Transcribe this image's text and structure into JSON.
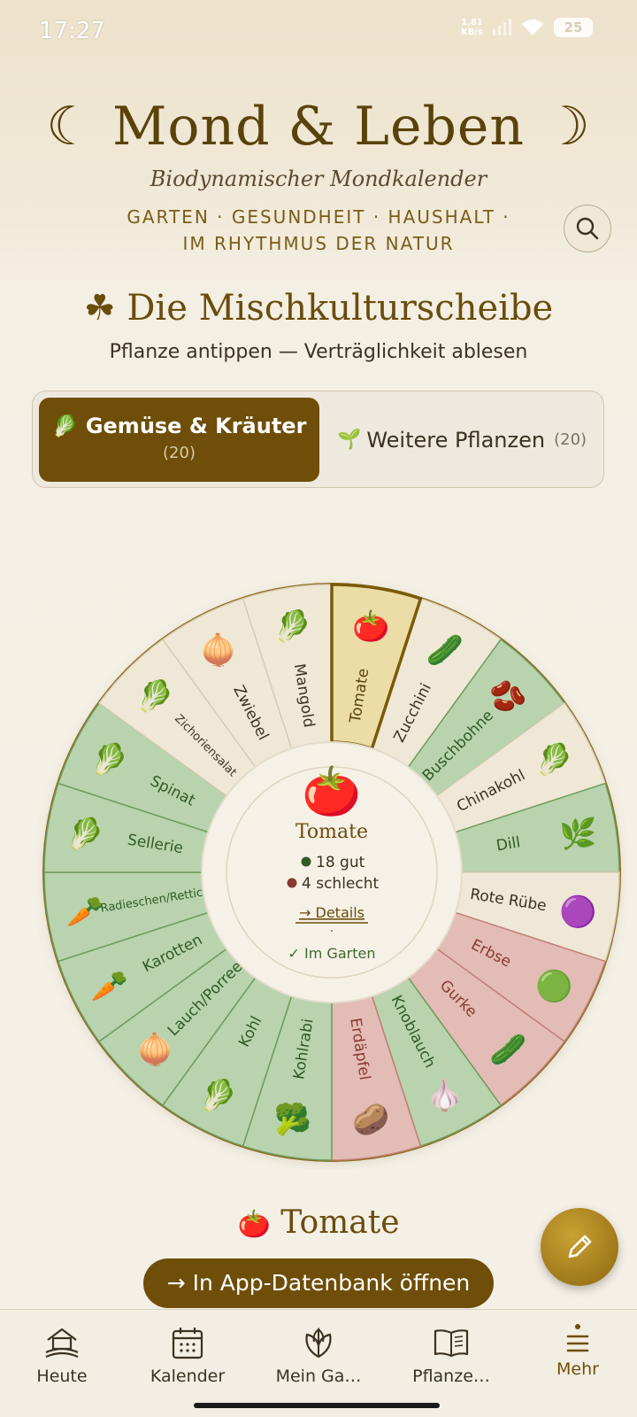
{
  "status_bar": {
    "time": "17:27",
    "net_speed_value": "1,81",
    "net_speed_unit": "KB/s",
    "battery": "25"
  },
  "header": {
    "title": "☾ Mond & Leben ☽",
    "subtitle": "Biodynamischer Mondkalender",
    "tagline_line1": "GARTEN · GESUNDHEIT · HAUSHALT ·",
    "tagline_line2": "IM RHYTHMUS DER NATUR"
  },
  "section": {
    "title": "☘ Die Mischkulturscheibe",
    "hint": "Pflanze antippen — Verträglichkeit ablesen"
  },
  "tabs": [
    {
      "icon": "🥬",
      "label": "Gemüse & Kräuter",
      "count": "(20)",
      "active": true
    },
    {
      "icon": "🌱",
      "label": "Weitere Pflanzen",
      "count": "(20)",
      "active": false
    }
  ],
  "wheel": {
    "segments": [
      {
        "name": "Tomate",
        "icon": "🍅",
        "status": "selected"
      },
      {
        "name": "Zucchini",
        "icon": "🥒",
        "status": "neutral"
      },
      {
        "name": "Buschbohne",
        "icon": "🫘",
        "status": "good"
      },
      {
        "name": "Chinakohl",
        "icon": "🥬",
        "status": "neutral"
      },
      {
        "name": "Dill",
        "icon": "🌿",
        "status": "good"
      },
      {
        "name": "Rote Rübe",
        "icon": "🟣",
        "status": "neutral"
      },
      {
        "name": "Erbse",
        "icon": "🟢",
        "status": "bad"
      },
      {
        "name": "Gurke",
        "icon": "🥒",
        "status": "bad"
      },
      {
        "name": "Knoblauch",
        "icon": "🧄",
        "status": "good"
      },
      {
        "name": "Erdäpfel",
        "icon": "🥔",
        "status": "bad"
      },
      {
        "name": "Kohlrabi",
        "icon": "🥦",
        "status": "good"
      },
      {
        "name": "Kohl",
        "icon": "🥬",
        "status": "good"
      },
      {
        "name": "Lauch/Porree",
        "icon": "🧅",
        "status": "good"
      },
      {
        "name": "Karotten",
        "icon": "🥕",
        "status": "good"
      },
      {
        "name": "Radieschen/Rettich",
        "icon": "🥕",
        "status": "good"
      },
      {
        "name": "Sellerie",
        "icon": "🥬",
        "status": "good"
      },
      {
        "name": "Spinat",
        "icon": "🥬",
        "status": "good"
      },
      {
        "name": "Zichoriensalat",
        "icon": "🥬",
        "status": "neutral"
      },
      {
        "name": "Zwiebel",
        "icon": "🧅",
        "status": "neutral"
      },
      {
        "name": "Mangold",
        "icon": "🥬",
        "status": "neutral"
      }
    ],
    "center": {
      "icon": "🍅",
      "name": "Tomate",
      "good": "18 gut",
      "bad": "4 schlecht",
      "details": "→ Details",
      "separator": "·",
      "in_garden": "✓ Im Garten"
    },
    "colors": {
      "good_fill": "#b9d3ae",
      "good_stroke": "#6f9c5f",
      "good_text": "#2f5a26",
      "bad_fill": "#e2bcb5",
      "bad_stroke": "#c27f76",
      "bad_text": "#8a3a32",
      "neutral_fill": "#efe8d6",
      "neutral_stroke": "#d6cdb6",
      "neutral_text": "#3a3222",
      "selected_fill": "#ecdca5",
      "selected_stroke": "#7a5a08"
    }
  },
  "detail": {
    "icon": "🍅",
    "title": "Tomate",
    "open_db_button": "→ In App-Datenbank öffnen"
  },
  "fab": {
    "icon": "pencil-icon"
  },
  "nav": [
    {
      "label": "Heute",
      "icon": "home-icon",
      "active": false
    },
    {
      "label": "Kalender",
      "icon": "calendar-icon",
      "active": false
    },
    {
      "label": "Mein Ga…",
      "icon": "leaf-icon",
      "active": false
    },
    {
      "label": "Pflanze…",
      "icon": "book-icon",
      "active": false
    },
    {
      "label": "Mehr",
      "icon": "menu-icon",
      "active": true
    }
  ]
}
